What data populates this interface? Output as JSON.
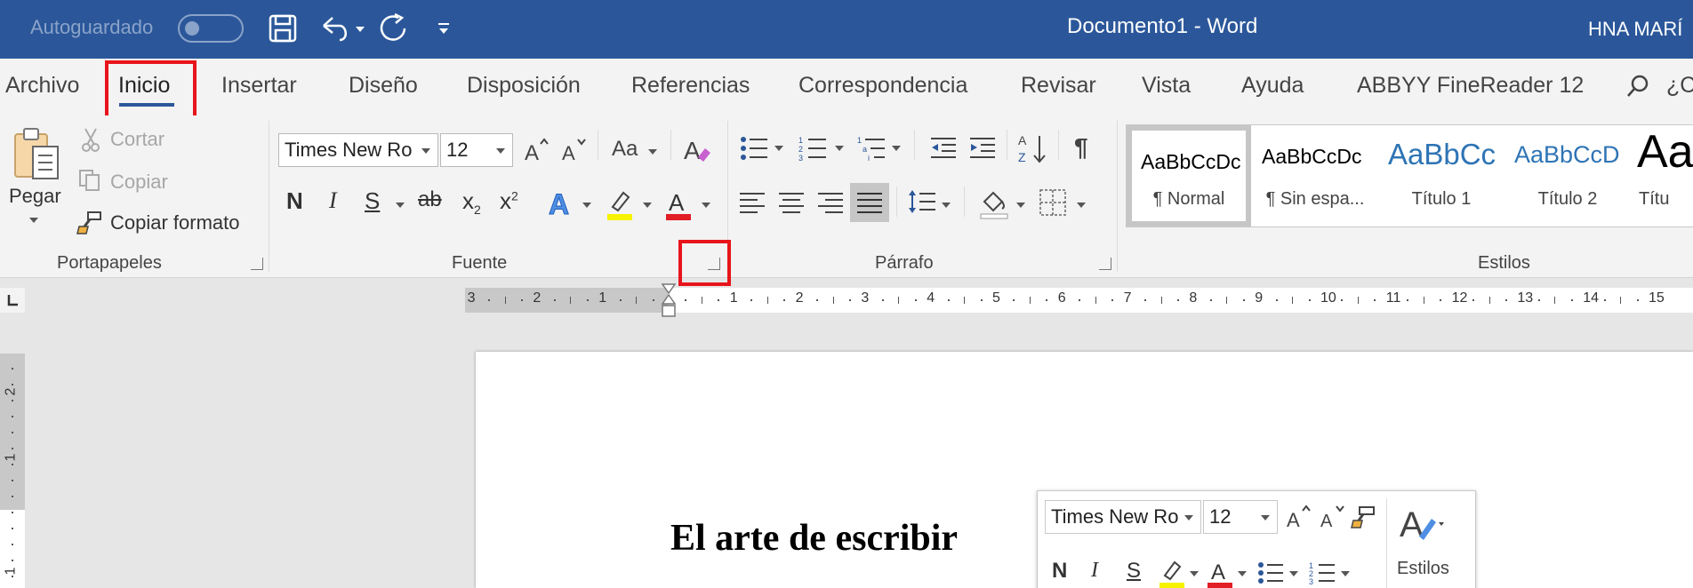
{
  "titlebar": {
    "autosave_label": "Autoguardado",
    "document_title": "Documento1  -  Word",
    "user": "HNA MARÍ",
    "icons": [
      "toggle-switch",
      "save-icon",
      "undo-icon",
      "redo-icon",
      "customize-icon"
    ]
  },
  "tabs": [
    "Archivo",
    "Inicio",
    "Insertar",
    "Diseño",
    "Disposición",
    "Referencias",
    "Correspondencia",
    "Revisar",
    "Vista",
    "Ayuda",
    "ABBYY FineReader 12"
  ],
  "active_tab": "Inicio",
  "tell_me": "¿C",
  "clipboard": {
    "paste": "Pegar",
    "cut": "Cortar",
    "copy": "Copiar",
    "format_painter": "Copiar formato",
    "group": "Portapapeles"
  },
  "font": {
    "name": "Times New Ro",
    "size": "12",
    "change_case": "Aa",
    "group": "Fuente",
    "format_buttons": [
      "N",
      "I",
      "S",
      "ab",
      "x",
      "x"
    ]
  },
  "paragraph": {
    "group": "Párrafo",
    "show_marks": "¶"
  },
  "styles": {
    "group": "Estilos",
    "items": [
      {
        "sample": "AaBbCcDc",
        "name": "¶ Normal"
      },
      {
        "sample": "AaBbCcDc",
        "name": "¶ Sin espa..."
      },
      {
        "sample": "AaBbCc",
        "name": "Título 1"
      },
      {
        "sample": "AaBbCcD",
        "name": "Título 2"
      },
      {
        "sample": "Aa",
        "name": "Títu"
      }
    ]
  },
  "ruler": {
    "numbers": [
      "3",
      "2",
      "1",
      "1",
      "2",
      "3",
      "4",
      "5",
      "6",
      "7",
      "8",
      "9",
      "10",
      "11",
      "12",
      "13",
      "14",
      "15"
    ],
    "vertical_numbers": [
      "2",
      "1",
      "1"
    ]
  },
  "document": {
    "title": "El arte de escribir"
  },
  "mini_toolbar": {
    "font": "Times New Ro",
    "size": "12",
    "styles_label": "Estilos"
  },
  "colors": {
    "accent": "#2b579a",
    "highlight": "#e8141b"
  }
}
